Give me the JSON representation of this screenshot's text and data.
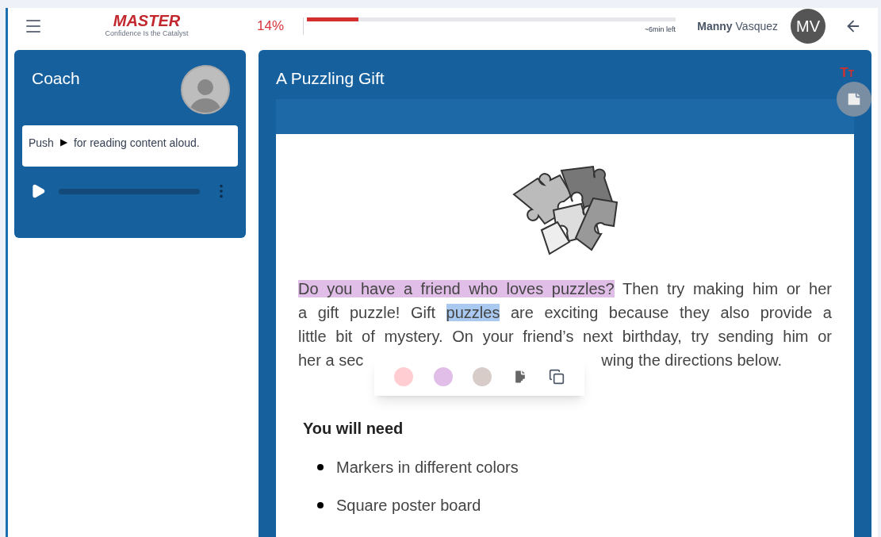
{
  "header": {
    "logo_word": "MASTER",
    "tagline": "Confidence Is the Catalyst",
    "progress_percent": "14%",
    "progress": {
      "level": 0.14
    },
    "time_left": "~6min left",
    "user_first": "Manny",
    "user_last": "Vasquez",
    "initials": "MV"
  },
  "coach": {
    "title": "Coach",
    "hint_before": "Push",
    "hint_after": "for reading content aloud.",
    "play_symbol": "▶"
  },
  "reader": {
    "title": "A Puzzling Gift",
    "text_size_glyphs": [
      "T",
      "T"
    ],
    "paragraph_lines": [
      [
        {
          "text": "Do you have a friend who loves puzzles?",
          "color": "#e1bee7"
        },
        {
          "text": " Then try making him or her"
        }
      ],
      [
        {
          "text": "a gift puzzle! Gift "
        },
        {
          "text": "puzzles",
          "color": "#a9c9f0"
        },
        {
          "text": " are exciting because they also provide a"
        }
      ],
      [
        {
          "text": "little bit of mystery. On your friend’s next birthday, try sending him or"
        }
      ],
      [
        {
          "text": "her a sec"
        },
        {
          "kind": "gap"
        },
        {
          "text": "wing the directions below."
        }
      ]
    ],
    "highlight_menu": [
      {
        "kind": "color",
        "color": "#ffcdd2"
      },
      {
        "kind": "color",
        "color": "#e1bee7"
      },
      {
        "kind": "color",
        "color": "#d7ccc8"
      },
      {
        "kind": "note"
      },
      {
        "kind": "copy"
      }
    ],
    "section_heading": "You will need",
    "list": [
      "Markers in different colors",
      "Square poster board"
    ]
  }
}
